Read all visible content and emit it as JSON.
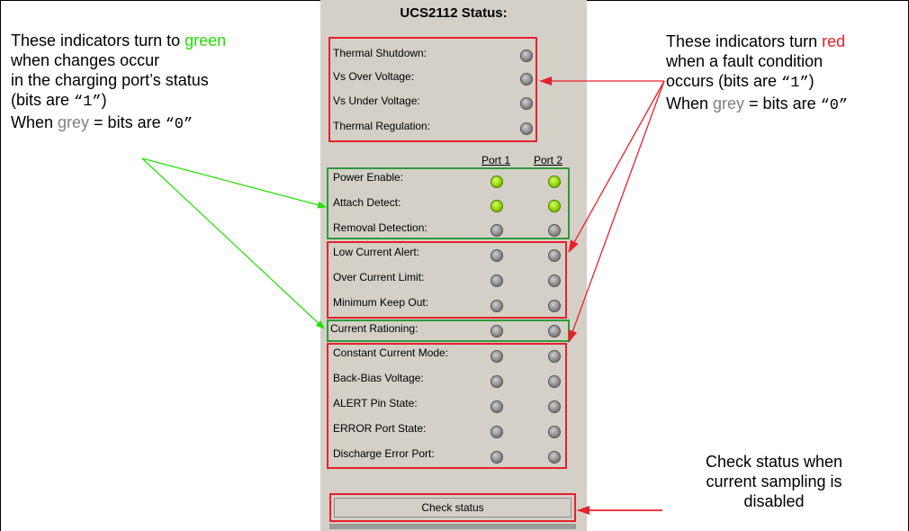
{
  "panel": {
    "title": "UCS2112 Status:",
    "port1_header": "Port 1",
    "port2_header": "Port 2",
    "button_label": "Check status",
    "thermal_rows": [
      {
        "label": "Thermal Shutdown:",
        "state": "grey"
      },
      {
        "label": "Vs Over Voltage:",
        "state": "grey"
      },
      {
        "label": "Vs Under Voltage:",
        "state": "grey"
      },
      {
        "label": "Thermal Regulation:",
        "state": "grey"
      }
    ],
    "port_rows": [
      {
        "label": "Power Enable:",
        "p1": "green",
        "p2": "green"
      },
      {
        "label": "Attach Detect:",
        "p1": "green",
        "p2": "green"
      },
      {
        "label": "Removal Detection:",
        "p1": "grey",
        "p2": "grey"
      },
      {
        "label": "Low Current Alert:",
        "p1": "grey",
        "p2": "grey"
      },
      {
        "label": "Over Current Limit:",
        "p1": "grey",
        "p2": "grey"
      },
      {
        "label": "Minimum Keep Out:",
        "p1": "grey",
        "p2": "grey"
      },
      {
        "label": "Current Rationing:",
        "p1": "grey",
        "p2": "grey"
      },
      {
        "label": "Constant Current Mode:",
        "p1": "grey",
        "p2": "grey"
      },
      {
        "label": "Back-Bias Voltage:",
        "p1": "grey",
        "p2": "grey"
      },
      {
        "label": "ALERT Pin State:",
        "p1": "grey",
        "p2": "grey"
      },
      {
        "label": "ERROR Port State:",
        "p1": "grey",
        "p2": "grey"
      },
      {
        "label": "Discharge Error Port:",
        "p1": "grey",
        "p2": "grey"
      }
    ]
  },
  "annotations": {
    "left": {
      "line1_pre": "These indicators turn to ",
      "line1_color_word": "green",
      "line2": "when changes occur",
      "line3": "in the charging port’s status",
      "line4_pre": "(bits are ",
      "line4_code": "“1”",
      "line4_post": ")",
      "line5_pre": "When ",
      "line5_color_word": "grey",
      "line5_mid": " = bits are ",
      "line5_code": "“0”"
    },
    "right": {
      "line1_pre": "These indicators turn ",
      "line1_color_word": "red",
      "line2": "when a fault condition",
      "line3_pre": "occurs (bits are ",
      "line3_code": "“1”",
      "line3_post": ")",
      "line4_pre": "When ",
      "line4_color_word": "grey",
      "line4_mid": " = bits are ",
      "line4_code": "“0”"
    },
    "bottom_right": {
      "line1": "Check status when",
      "line2": "current sampling is",
      "line3": "disabled"
    }
  },
  "colors": {
    "indicator_green": "#8ed400",
    "indicator_grey": "#8c8c8c",
    "highlight_red": "#e8202a",
    "highlight_green": "#2e9a3a",
    "arrow_green": "#22e000",
    "arrow_red": "#e8202a"
  }
}
